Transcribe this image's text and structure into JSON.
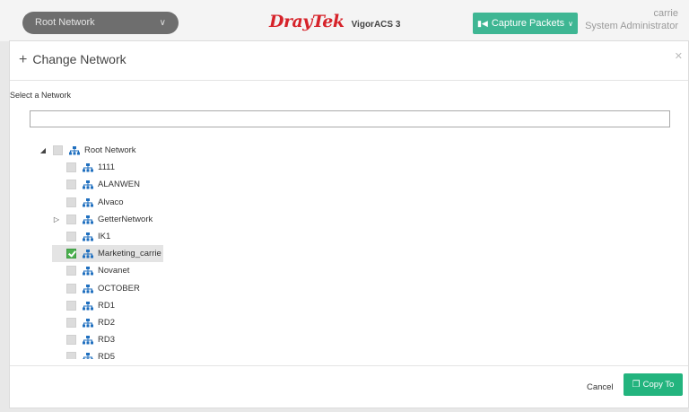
{
  "topbar": {
    "network_select": "Root Network",
    "brand": "DrayTek",
    "product": "VigorACS 3",
    "capture_label": "Capture Packets",
    "user_name": "carrie",
    "user_role": "System Administrator"
  },
  "modal": {
    "title": "Change Network",
    "select_label": "Select a Network",
    "search_value": "",
    "cancel_label": "Cancel",
    "copy_label": "Copy To"
  },
  "tree": {
    "root": {
      "label": "Root Network",
      "expanded": true,
      "checked": false
    },
    "children": [
      {
        "label": "1111",
        "checked": false,
        "expandable": false
      },
      {
        "label": "ALANWEN",
        "checked": false,
        "expandable": false
      },
      {
        "label": "Alvaco",
        "checked": false,
        "expandable": false
      },
      {
        "label": "GetterNetwork",
        "checked": false,
        "expandable": true
      },
      {
        "label": "IK1",
        "checked": false,
        "expandable": false
      },
      {
        "label": "Marketing_carrie",
        "checked": true,
        "expandable": false
      },
      {
        "label": "Novanet",
        "checked": false,
        "expandable": false
      },
      {
        "label": "OCTOBER",
        "checked": false,
        "expandable": false
      },
      {
        "label": "RD1",
        "checked": false,
        "expandable": false
      },
      {
        "label": "RD2",
        "checked": false,
        "expandable": false
      },
      {
        "label": "RD3",
        "checked": false,
        "expandable": false
      },
      {
        "label": "RD5",
        "checked": false,
        "expandable": false
      }
    ]
  },
  "colors": {
    "accent": "#3eb693",
    "copy_button": "#23b47e",
    "check": "#4bb04f",
    "brand": "#d6232a",
    "network_icon": "#1f6fbf"
  },
  "icons": {
    "network": "network-tree-icon",
    "capture": "video-camera-icon",
    "copy": "copy-icon",
    "close": "close-icon",
    "add": "plus-icon"
  }
}
